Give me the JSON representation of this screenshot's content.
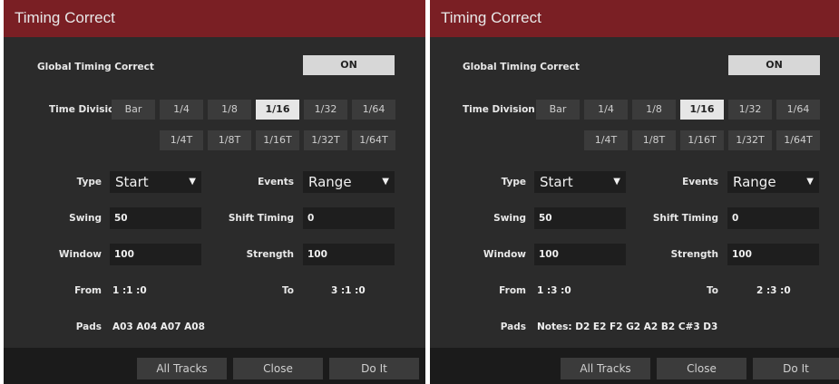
{
  "dialogs": [
    {
      "title": "Timing Correct",
      "global_label": "Global Timing Correct",
      "global_value": "ON",
      "time_division_label": "Time Division",
      "divisions_row1": [
        "Bar",
        "1/4",
        "1/8",
        "1/16",
        "1/32",
        "1/64"
      ],
      "divisions_row2": [
        "1/4T",
        "1/8T",
        "1/16T",
        "1/32T",
        "1/64T"
      ],
      "selected_division": "1/16",
      "type_label": "Type",
      "type_value": "Start",
      "events_label": "Events",
      "events_value": "Range",
      "swing_label": "Swing",
      "swing_value": "50",
      "shift_label": "Shift Timing",
      "shift_value": "0",
      "window_label": "Window",
      "window_value": "100",
      "strength_label": "Strength",
      "strength_value": "100",
      "from_label": "From",
      "from_value": "1 :1 :0",
      "to_label": "To",
      "to_value": "3 :1 :0",
      "pads_label": "Pads",
      "pads_value": "A03 A04 A07 A08",
      "footer": [
        "All Tracks",
        "Close",
        "Do It"
      ]
    },
    {
      "title": "Timing Correct",
      "global_label": "Global Timing Correct",
      "global_value": "ON",
      "time_division_label": "Time Division",
      "divisions_row1": [
        "Bar",
        "1/4",
        "1/8",
        "1/16",
        "1/32",
        "1/64"
      ],
      "divisions_row2": [
        "1/4T",
        "1/8T",
        "1/16T",
        "1/32T",
        "1/64T"
      ],
      "selected_division": "1/16",
      "type_label": "Type",
      "type_value": "Start",
      "events_label": "Events",
      "events_value": "Range",
      "swing_label": "Swing",
      "swing_value": "50",
      "shift_label": "Shift Timing",
      "shift_value": "0",
      "window_label": "Window",
      "window_value": "100",
      "strength_label": "Strength",
      "strength_value": "100",
      "from_label": "From",
      "from_value": "1 :3 :0",
      "to_label": "To",
      "to_value": "2 :3 :0",
      "pads_label": "Pads",
      "pads_value": "Notes: D2 E2 F2 G2 A2 B2 C#3 D3",
      "footer": [
        "All Tracks",
        "Close",
        "Do It"
      ]
    }
  ]
}
